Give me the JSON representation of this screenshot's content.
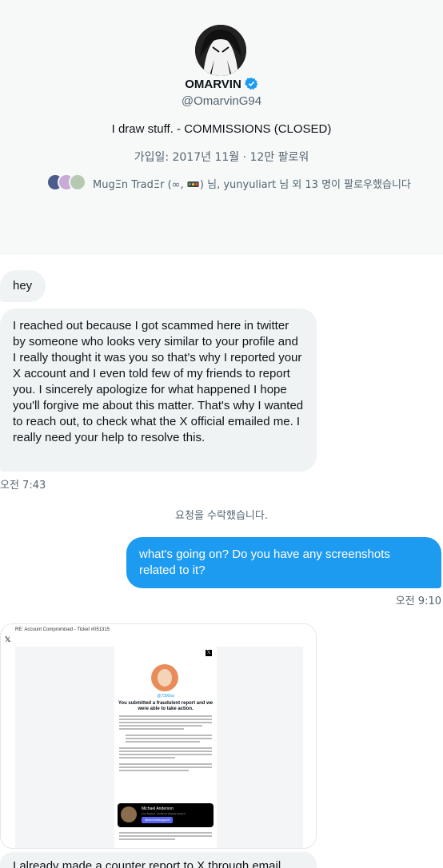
{
  "profile": {
    "display_name": "OMARVIN",
    "handle": "@OmarvinG94",
    "bio": "I draw stuff. - COMMISSIONS (CLOSED)",
    "meta": "가입일: 2017년 11월 · 12만 팔로워",
    "followed_by": "MugΞn TradΞr (∞, 🚥) 님, yunyuliart 님 외 13 명이 팔로우했습니다"
  },
  "messages": [
    {
      "text": "hey"
    },
    {
      "text": "I reached out because I got scammed here in twitter by someone who looks very similar to your profile and I really thought it was you so that's why I reported your X account and I even told few of my friends to report you. I sincerely apologize for what happened I hope you'll forgive me about this matter. That's why I wanted to reach out, to check what the X official emailed me. I really need your help to resolve this."
    },
    {
      "text": "what's going on? Do you have any screenshots related to it?"
    },
    {
      "text": "I already made a counter report to X through email"
    }
  ],
  "timestamps": {
    "incoming": "오전 7:43",
    "outgoing": "오전 9:10"
  },
  "system_message": "요청을 수락했습니다.",
  "screenshot": {
    "subject": "RE: Account Compromised - Ticket #051315",
    "handle": "@7300sa",
    "heading": "You submitted a fraudulent report and we were able to take action.",
    "contact_name": "Michael Anderson",
    "contact_role": "Live Support • Verified X Dispute Support",
    "contact_button": "@michaelsupport"
  },
  "colors": {
    "accent": "#1d9bf0",
    "bubble_in": "#eff3f4",
    "muted": "#536471"
  }
}
